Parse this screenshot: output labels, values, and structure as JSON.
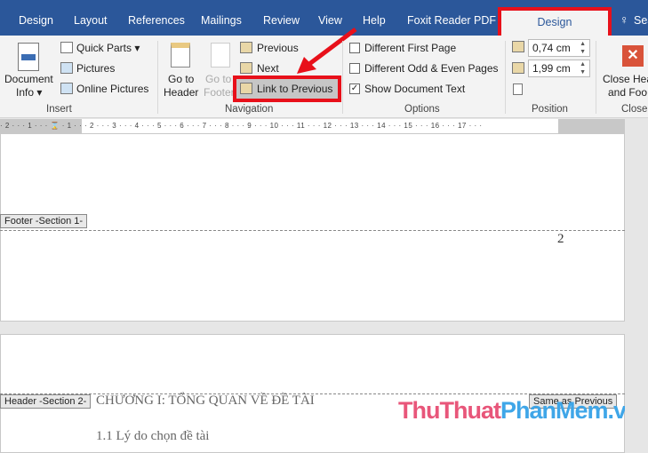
{
  "tabs": [
    "Design",
    "Layout",
    "References",
    "Mailings",
    "Review",
    "View",
    "Help",
    "Foxit Reader PDF"
  ],
  "active_tab": "Design",
  "search_label": "Sea",
  "ribbon": {
    "insert": {
      "document_info": "Document",
      "document_info2": "Info ▾",
      "quick_parts": "Quick Parts ▾",
      "pictures": "Pictures",
      "online_pictures": "Online Pictures",
      "label": "Insert"
    },
    "navigation": {
      "go_to_header": "Go to",
      "go_to_header2": "Header",
      "go_to_footer": "Go to",
      "go_to_footer2": "Footer",
      "previous": "Previous",
      "next": "Next",
      "link_to_previous": "Link to Previous",
      "label": "Navigation"
    },
    "options": {
      "different_first_page": "Different First Page",
      "different_odd_even": "Different Odd & Even Pages",
      "show_document_text": "Show Document Text",
      "label": "Options"
    },
    "position": {
      "header_from_top": "0,74 cm",
      "footer_from_bottom": "1,99 cm",
      "label": "Position"
    },
    "close": {
      "close_label": "Close Hea",
      "close_label2": "and Foo",
      "label": "Close"
    }
  },
  "ruler": "· 2 · · · 1 · · ·   ⌛ · 1 · · · 2 · · · 3 · · · 4 · · · 5 · · · 6 · · · 7 · · · 8 · · · 9 · · · 10 · · · 11 · · · 12 · · · 13 · · · 14 · · · 15 · · · 16 · · · 17 · · ·",
  "document": {
    "footer_label": "Footer -Section 1-",
    "page_number": "2",
    "header_label": "Header -Section 2-",
    "same_as_previous": "Same as Previous",
    "heading": "CHƯƠNG I: TỔNG QUAN VỀ ĐỀ TÀI",
    "subheading": "1.1 Lý do chọn đề tài"
  },
  "watermark": {
    "part1": "ThuThuat",
    "part2": "PhanMem",
    "part3": ".vn"
  },
  "colors": {
    "tabbar": "#2b579a",
    "highlight": "#e8101a"
  }
}
